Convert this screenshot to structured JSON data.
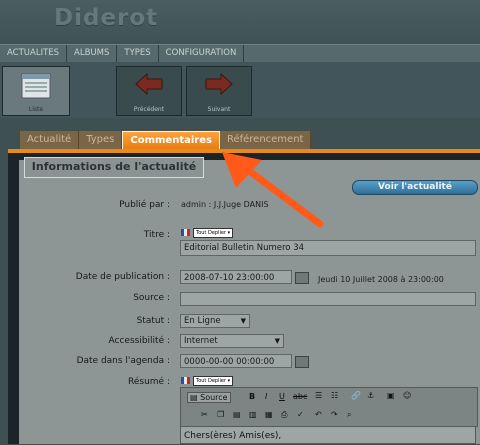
{
  "app": {
    "title": "Diderot"
  },
  "nav": {
    "items": [
      "ACTUALITES",
      "ALBUMS",
      "TYPES",
      "CONFIGURATION"
    ]
  },
  "toolbar": {
    "list_label": "Liste",
    "prev_label": "Précédent",
    "next_label": "Suivant"
  },
  "tabs": [
    "Actualité",
    "Types",
    "Commentaires",
    "Référencement"
  ],
  "active_tab": "Commentaires",
  "section": {
    "title": "Informations de l'actualité",
    "view_button": "Voir l'actualité"
  },
  "form": {
    "published_by": {
      "label": "Publié par :",
      "value": "admin : J.J.Juge DANIS"
    },
    "title": {
      "label": "Titre :",
      "lang_button": "Tout Deplier",
      "value": "Editorial Bulletin Numero 34"
    },
    "pub_date": {
      "label": "Date de publication :",
      "value": "2008-07-10 23:00:00",
      "readable": "Jeudi 10 Juillet 2008 à 23:00:00"
    },
    "source": {
      "label": "Source :",
      "value": ""
    },
    "status": {
      "label": "Statut :",
      "value": "En Ligne"
    },
    "accessibility": {
      "label": "Accessibilité :",
      "value": "Internet"
    },
    "agenda_date": {
      "label": "Date dans l'agenda :",
      "value": "0000-00-00 00:00:00"
    },
    "summary": {
      "label": "Résumé :",
      "lang_button": "Tout Deplier",
      "source_button": "Source",
      "content": "Chers(ères) Amis(es),"
    }
  },
  "colors": {
    "accent": "#e8891c",
    "arrow": "#ff5a1a",
    "link_button": "#3d83ad"
  }
}
